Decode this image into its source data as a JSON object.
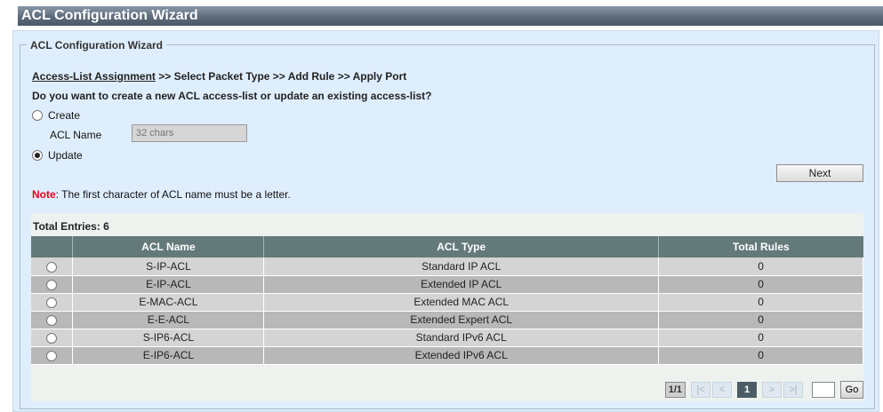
{
  "window": {
    "title": "ACL Configuration Wizard"
  },
  "fieldset": {
    "legend": "ACL Configuration Wizard"
  },
  "steps": {
    "current": "Access-List Assignment",
    "rest": " >> Select Packet Type >> Add Rule >> Apply Port"
  },
  "question": "Do you want to create a new ACL access-list or update an existing access-list?",
  "options": {
    "create": {
      "label": "Create",
      "checked": false
    },
    "update": {
      "label": "Update",
      "checked": true
    }
  },
  "acl_name": {
    "label": "ACL Name",
    "placeholder": "32 chars"
  },
  "next_button": "Next",
  "note": {
    "label": "Note",
    "text": ":  The first character of ACL name must be a letter."
  },
  "table": {
    "total": "Total Entries: 6",
    "columns": [
      "",
      "ACL Name",
      "ACL Type",
      "Total Rules"
    ],
    "rows": [
      {
        "name": "S-IP-ACL",
        "type": "Standard IP ACL",
        "rules": "0"
      },
      {
        "name": "E-IP-ACL",
        "type": "Extended IP ACL",
        "rules": "0"
      },
      {
        "name": "E-MAC-ACL",
        "type": "Extended MAC ACL",
        "rules": "0"
      },
      {
        "name": "E-E-ACL",
        "type": "Extended Expert ACL",
        "rules": "0"
      },
      {
        "name": "S-IP6-ACL",
        "type": "Standard IPv6 ACL",
        "rules": "0"
      },
      {
        "name": "E-IP6-ACL",
        "type": "Extended IPv6 ACL",
        "rules": "0"
      }
    ]
  },
  "pager": {
    "info": "1/1",
    "first": "|<",
    "prev": "<",
    "current": "1",
    "next": ">",
    "last": ">|",
    "go": "Go"
  }
}
